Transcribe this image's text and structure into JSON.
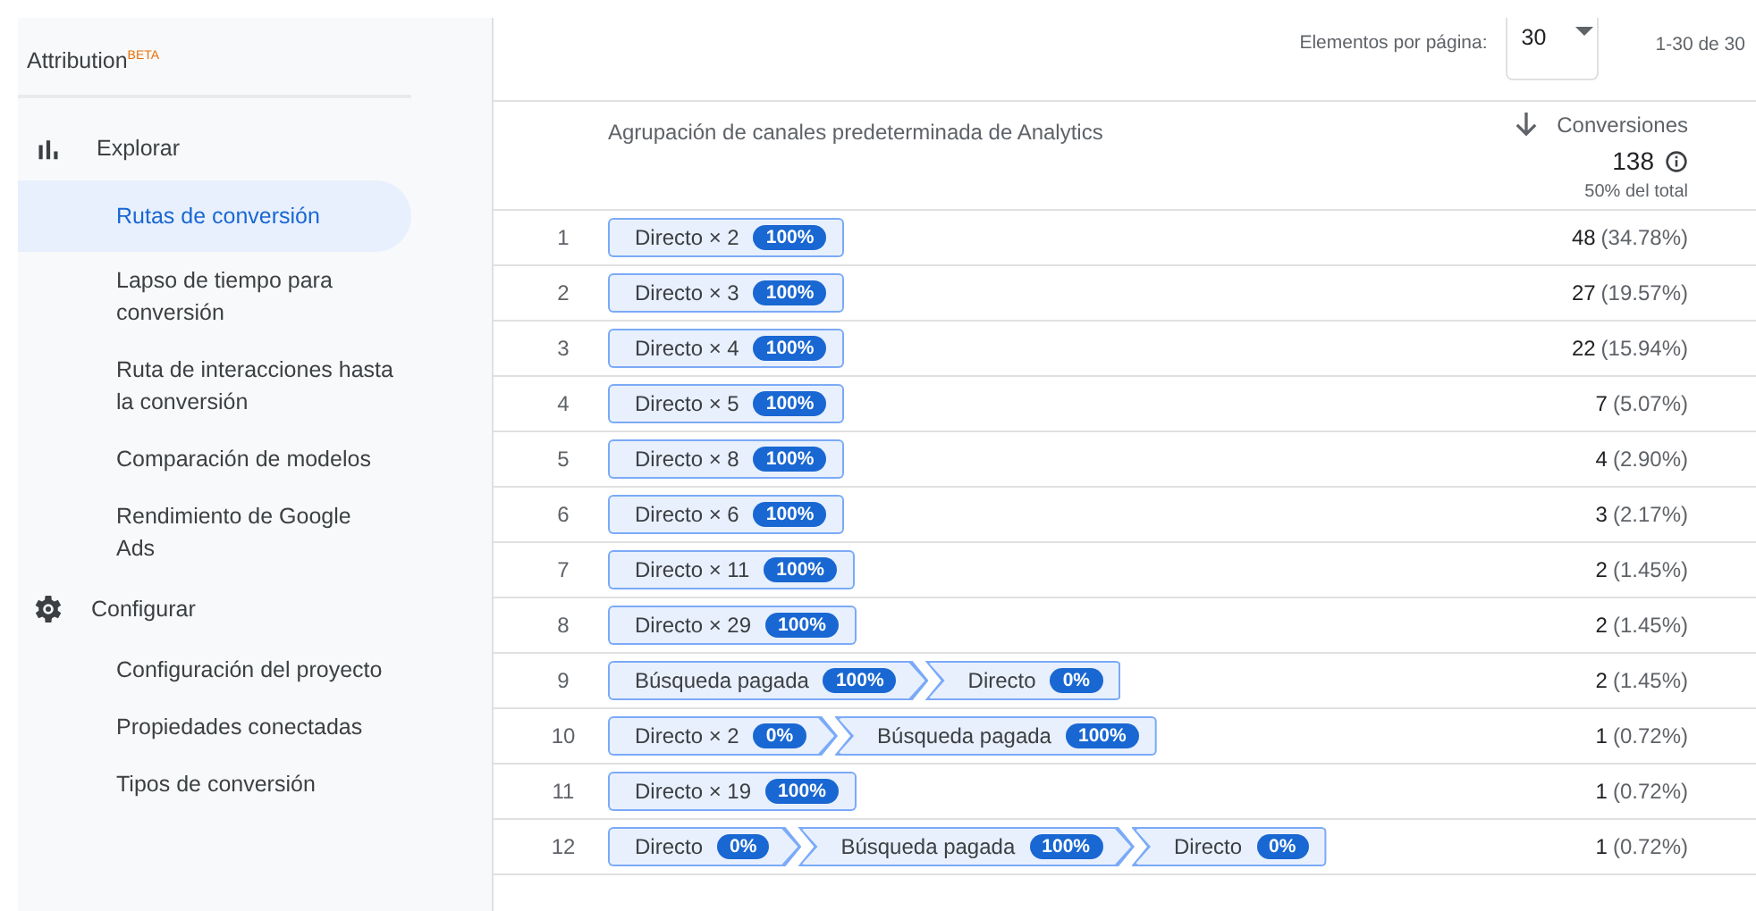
{
  "sidebar": {
    "title": "Attribution$^{BETA}$",
    "sections": [
      {
        "label": "Explorar",
        "kind": "chart",
        "children": [
          {
            "label": "Rutas de conversión",
            "selected": true
          },
          {
            "label": "Lapso de tiempo para conversión",
            "selected": false
          },
          {
            "label": "Ruta de interacciones hasta la conversión",
            "selected": false
          },
          {
            "label": "Comparación de modelos",
            "selected": false
          },
          {
            "label": "Rendimiento de Google Ads",
            "selected": false
          }
        ]
      },
      {
        "label": "Configurar",
        "kind": "gear",
        "children": [
          {
            "label": "Configuración del proyecto",
            "selected": false
          },
          {
            "label": "Propiedades conectadas",
            "selected": false
          },
          {
            "label": "Tipos de conversión",
            "selected": false
          }
        ]
      }
    ]
  },
  "pagination": {
    "label": "Elementos por página:",
    "page_size": "30",
    "range": "1-30 de 30"
  },
  "table": {
    "column_1": "Agrupación de canales predeterminada de Analytics",
    "column_2": "Conversiones",
    "total": "138",
    "total_note": "50% del total",
    "rows": [
      {
        "index": "1",
        "path": [
          {
            "label": "Directo × 2",
            "badge": "100%"
          }
        ],
        "count": "48",
        "share": "(34.78%)"
      },
      {
        "index": "2",
        "path": [
          {
            "label": "Directo × 3",
            "badge": "100%"
          }
        ],
        "count": "27",
        "share": "(19.57%)"
      },
      {
        "index": "3",
        "path": [
          {
            "label": "Directo × 4",
            "badge": "100%"
          }
        ],
        "count": "22",
        "share": "(15.94%)"
      },
      {
        "index": "4",
        "path": [
          {
            "label": "Directo × 5",
            "badge": "100%"
          }
        ],
        "count": "7",
        "share": "(5.07%)"
      },
      {
        "index": "5",
        "path": [
          {
            "label": "Directo × 8",
            "badge": "100%"
          }
        ],
        "count": "4",
        "share": "(2.90%)"
      },
      {
        "index": "6",
        "path": [
          {
            "label": "Directo × 6",
            "badge": "100%"
          }
        ],
        "count": "3",
        "share": "(2.17%)"
      },
      {
        "index": "7",
        "path": [
          {
            "label": "Directo × 11",
            "badge": "100%"
          }
        ],
        "count": "2",
        "share": "(1.45%)"
      },
      {
        "index": "8",
        "path": [
          {
            "label": "Directo × 29",
            "badge": "100%"
          }
        ],
        "count": "2",
        "share": "(1.45%)"
      },
      {
        "index": "9",
        "path": [
          {
            "label": "Búsqueda pagada",
            "badge": "100%"
          },
          {
            "label": "Directo",
            "badge": "0%"
          }
        ],
        "count": "2",
        "share": "(1.45%)"
      },
      {
        "index": "10",
        "path": [
          {
            "label": "Directo × 2",
            "badge": "0%"
          },
          {
            "label": "Búsqueda pagada",
            "badge": "100%"
          }
        ],
        "count": "1",
        "share": "(0.72%)"
      },
      {
        "index": "11",
        "path": [
          {
            "label": "Directo × 19",
            "badge": "100%"
          }
        ],
        "count": "1",
        "share": "(0.72%)"
      },
      {
        "index": "12",
        "path": [
          {
            "label": "Directo",
            "badge": "0%"
          },
          {
            "label": "Búsqueda pagada",
            "badge": "100%"
          },
          {
            "label": "Directo",
            "badge": "0%"
          }
        ],
        "count": "1",
        "share": "(0.72%)"
      }
    ]
  }
}
